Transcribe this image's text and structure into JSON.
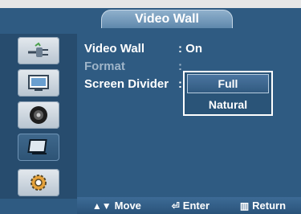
{
  "menu": {
    "title": "Video Wall"
  },
  "sidebar": {
    "items": [
      {
        "icon": "plug-icon"
      },
      {
        "icon": "picture-icon"
      },
      {
        "icon": "speaker-icon"
      },
      {
        "icon": "screen-icon"
      },
      {
        "icon": "gear-icon"
      }
    ],
    "active_index": 3
  },
  "settings": [
    {
      "label": "Video Wall",
      "value": ": On"
    },
    {
      "label": "Format",
      "value": ":"
    },
    {
      "label": "Screen Divider",
      "value": ":"
    }
  ],
  "dropdown": {
    "options": [
      "Full",
      "Natural"
    ],
    "selected": "Full"
  },
  "footer": {
    "move": "Move",
    "enter": "Enter",
    "return": "Return"
  },
  "colors": {
    "panel_bg": "#2f5b82",
    "sidebar_bg": "#274c6e",
    "text": "#ffffff",
    "dim_text": "#9fb5c9"
  }
}
